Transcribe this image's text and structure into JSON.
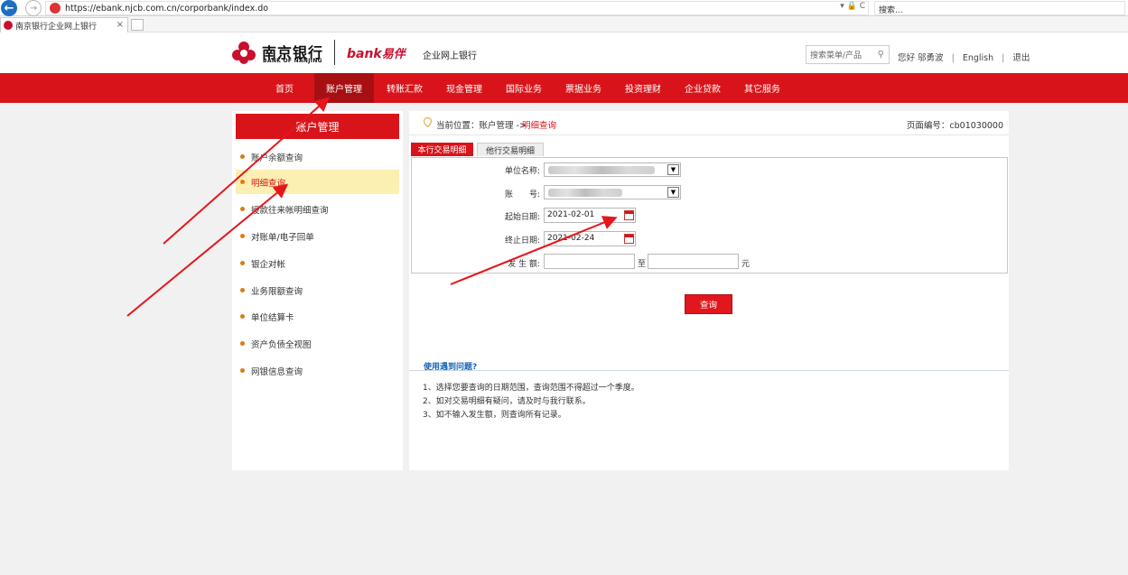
{
  "browser": {
    "url": "https://ebank.njcb.com.cn/corporbank/index.do",
    "search_placeholder": "搜索...",
    "addr_tools": "▾ 🔒 C",
    "tab_title": "南京银行企业网上银行",
    "tab_close": "×"
  },
  "header": {
    "logo_cn": "南京银行",
    "logo_en": "BANK OF NANJING",
    "ebank_brand": "bank",
    "ebank_brand_cn": "易伴",
    "site_title": "企业网上银行",
    "search_placeholder": "搜索菜单/产品",
    "greeting": "您好",
    "user_name": "邬勇波",
    "language_link": "English",
    "logout_link": "退出",
    "separator": "|"
  },
  "main_nav": {
    "items": [
      {
        "label": "首页"
      },
      {
        "label": "账户管理"
      },
      {
        "label": "转账汇款"
      },
      {
        "label": "现金管理"
      },
      {
        "label": "国际业务"
      },
      {
        "label": "票据业务"
      },
      {
        "label": "投资理财"
      },
      {
        "label": "企业贷款"
      },
      {
        "label": "其它服务"
      }
    ],
    "active_index": 1
  },
  "sidebar": {
    "title": "账户管理",
    "items": [
      {
        "label": "账户余额查询"
      },
      {
        "label": "明细查询"
      },
      {
        "label": "授款往来帐明细查询"
      },
      {
        "label": "对账单/电子回单"
      },
      {
        "label": "银企对帐"
      },
      {
        "label": "业务限额查询"
      },
      {
        "label": "单位结算卡"
      },
      {
        "label": "资产负债全视图"
      },
      {
        "label": "网银信息查询"
      }
    ],
    "active_index": 1
  },
  "breadcrumb": {
    "prefix": "当前位置：",
    "path": "账户管理 ->",
    "current": "明细查询",
    "page_code": "页面编号：cb01030000"
  },
  "content_tabs": {
    "active": "本行交易明细",
    "inactive": "他行交易明细"
  },
  "form": {
    "unit_name_label": "单位名称:",
    "account_label": "账　　号:",
    "start_date_label": "起始日期:",
    "start_date_value": "2021-02-01",
    "end_date_label": "终止日期:",
    "end_date_value": "2021-02-24",
    "amount_label": "发 生 额:",
    "amount_to": "至",
    "amount_unit": "元",
    "select_arrow": "▼",
    "query_button": "查询"
  },
  "help": {
    "title": "使用遇到问题?",
    "items": [
      "1、选择您要查询的日期范围，查询范围不得超过一个季度。",
      "2、如对交易明细有疑问，请及时与我行联系。",
      "3、如不输入发生额，则查询所有记录。"
    ]
  },
  "colors": {
    "brand_red": "#d8141a",
    "nav_active": "#a80f13",
    "sidebar_active_bg": "#fbefb2",
    "help_link": "#1566b7",
    "arrow_red": "#e5161c"
  }
}
